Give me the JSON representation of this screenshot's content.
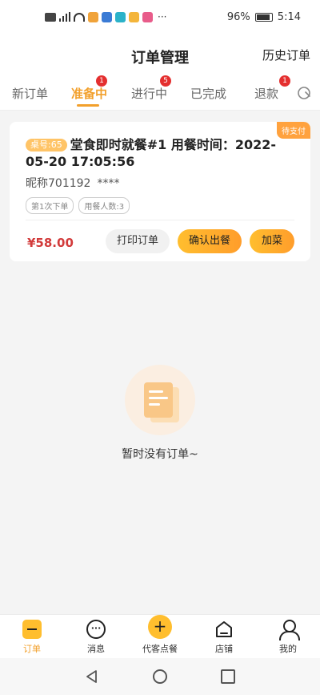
{
  "status_bar": {
    "battery": "96%",
    "time": "5:14",
    "more": "···"
  },
  "header": {
    "title": "订单管理",
    "history": "历史订单"
  },
  "tabs": [
    {
      "label": "新订单",
      "badge": ""
    },
    {
      "label": "准备中",
      "badge": "1"
    },
    {
      "label": "进行中",
      "badge": "5"
    },
    {
      "label": "已完成",
      "badge": ""
    },
    {
      "label": "退款",
      "badge": "1"
    }
  ],
  "order": {
    "status": "待支付",
    "table_no": "桌号:65",
    "title": "堂食即时就餐#1 用餐时间：2022-05-20 17:05:56",
    "nickname": "昵称701192",
    "masked": "****",
    "chips": [
      "第1次下单",
      "用餐人数:3"
    ],
    "price": "¥58.00",
    "btn_print": "打印订单",
    "btn_confirm": "确认出餐",
    "btn_add": "加菜"
  },
  "empty": {
    "text": "暂时没有订单~"
  },
  "bottom_nav": [
    {
      "label": "订单"
    },
    {
      "label": "消息"
    },
    {
      "label": "代客点餐"
    },
    {
      "label": "店铺"
    },
    {
      "label": "我的"
    }
  ],
  "colors": {
    "accent": "#f2a02c",
    "price": "#d23b3b",
    "badge": "#e42f2f"
  }
}
